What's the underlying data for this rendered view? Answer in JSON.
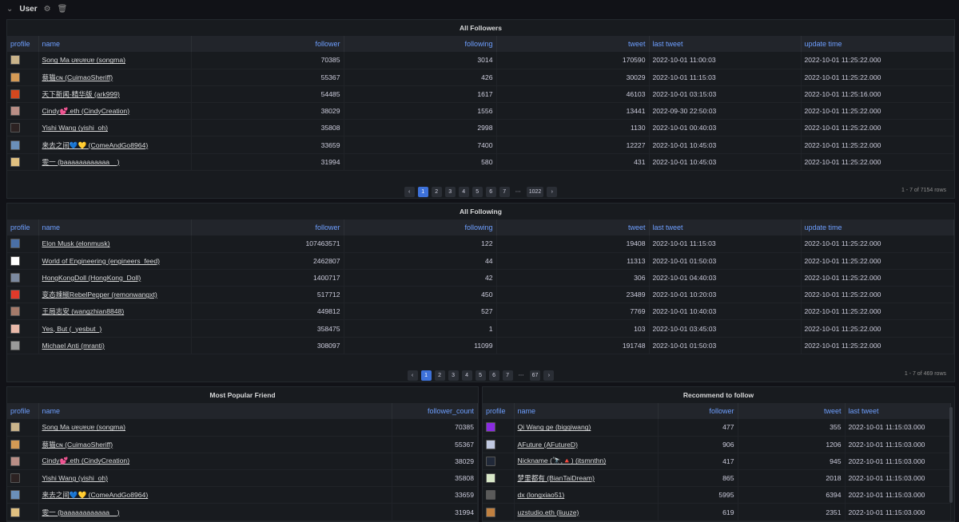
{
  "row": {
    "title": "User"
  },
  "followers": {
    "title": "All Followers",
    "headers": [
      "profile",
      "name",
      "follower",
      "following",
      "tweet",
      "last tweet",
      "update time"
    ],
    "rows": [
      {
        "color": "#c9b38a",
        "name": "Song Ma ʊɐʊɐʊɐ (songma)",
        "follower": "70385",
        "following": "3014",
        "tweet": "170590",
        "last": "2022-10-01 11:00:03",
        "update": "2022-10-01 11:25:22.000"
      },
      {
        "color": "#d49a55",
        "name": "蔡猫ᴄɴ (CuimaoSheriff)",
        "follower": "55367",
        "following": "426",
        "tweet": "30029",
        "last": "2022-10-01 11:15:03",
        "update": "2022-10-01 11:25:22.000"
      },
      {
        "color": "#d4481e",
        "name": "天下新闻-精华版 (ark999)",
        "follower": "54485",
        "following": "1617",
        "tweet": "46103",
        "last": "2022-10-01 03:15:03",
        "update": "2022-10-01 11:25:16.000"
      },
      {
        "color": "#b98e86",
        "name": "Cindy💕.eth (CindyCreation)",
        "follower": "38029",
        "following": "1556",
        "tweet": "13441",
        "last": "2022-09-30 22:50:03",
        "update": "2022-10-01 11:25:22.000"
      },
      {
        "color": "#2c2222",
        "name": "Yishi Wang (yishi_oh)",
        "follower": "35808",
        "following": "2998",
        "tweet": "1130",
        "last": "2022-10-01 00:40:03",
        "update": "2022-10-01 11:25:22.000"
      },
      {
        "color": "#6b8fb8",
        "name": "来去之间💙💛 (ComeAndGo8964)",
        "follower": "33659",
        "following": "7400",
        "tweet": "12227",
        "last": "2022-10-01 10:45:03",
        "update": "2022-10-01 11:25:22.000"
      },
      {
        "color": "#e0c080",
        "name": "雯一 (baaaaaaaaaaaa__)",
        "follower": "31994",
        "following": "580",
        "tweet": "431",
        "last": "2022-10-01 10:45:03",
        "update": "2022-10-01 11:25:22.000"
      }
    ],
    "pages": [
      "‹",
      "1",
      "2",
      "3",
      "4",
      "5",
      "6",
      "7",
      "⋯",
      "1022",
      "›"
    ],
    "active": "1",
    "count": "1 - 7 of 7154 rows"
  },
  "following": {
    "title": "All Following",
    "headers": [
      "profile",
      "name",
      "follower",
      "following",
      "tweet",
      "last tweet",
      "update time"
    ],
    "rows": [
      {
        "color": "#4a6fa5",
        "name": "Elon Musk (elonmusk)",
        "follower": "107463571",
        "following": "122",
        "tweet": "19408",
        "last": "2022-10-01 11:15:03",
        "update": "2022-10-01 11:25:22.000"
      },
      {
        "color": "#ffffff",
        "name": "World of Engineering (engineers_feed)",
        "follower": "2462807",
        "following": "44",
        "tweet": "11313",
        "last": "2022-10-01 01:50:03",
        "update": "2022-10-01 11:25:22.000"
      },
      {
        "color": "#7c8aa0",
        "name": "HongKongDoll (HongKong_Doll)",
        "follower": "1400717",
        "following": "42",
        "tweet": "306",
        "last": "2022-10-01 04:40:03",
        "update": "2022-10-01 11:25:22.000"
      },
      {
        "color": "#e03a2a",
        "name": "变态辣椒RebelPepper (remonwangxt)",
        "follower": "517712",
        "following": "450",
        "tweet": "23489",
        "last": "2022-10-01 10:20:03",
        "update": "2022-10-01 11:25:22.000"
      },
      {
        "color": "#a57a6a",
        "name": "王局志安 (wangzhian8848)",
        "follower": "449812",
        "following": "527",
        "tweet": "7769",
        "last": "2022-10-01 10:40:03",
        "update": "2022-10-01 11:25:22.000"
      },
      {
        "color": "#e8b8a8",
        "name": "Yes, But (_yesbut_)",
        "follower": "358475",
        "following": "1",
        "tweet": "103",
        "last": "2022-10-01 03:45:03",
        "update": "2022-10-01 11:25:22.000"
      },
      {
        "color": "#9a9a9a",
        "name": "Michael Anti (mranti)",
        "follower": "308097",
        "following": "11099",
        "tweet": "191748",
        "last": "2022-10-01 01:50:03",
        "update": "2022-10-01 11:25:22.000"
      }
    ],
    "pages": [
      "‹",
      "1",
      "2",
      "3",
      "4",
      "5",
      "6",
      "7",
      "⋯",
      "67",
      "›"
    ],
    "active": "1",
    "count": "1 - 7 of 469 rows"
  },
  "popular": {
    "title": "Most Popular Friend",
    "headers": [
      "profile",
      "name",
      "follower_count"
    ],
    "rows": [
      {
        "color": "#c9b38a",
        "name": "Song Ma ʊɐʊɐʊɐ (songma)",
        "count": "70385"
      },
      {
        "color": "#d49a55",
        "name": "蔡猫ᴄɴ (CuimaoSheriff)",
        "count": "55367"
      },
      {
        "color": "#b98e86",
        "name": "Cindy💕.eth (CindyCreation)",
        "count": "38029"
      },
      {
        "color": "#2c2222",
        "name": "Yishi Wang (yishi_oh)",
        "count": "35808"
      },
      {
        "color": "#6b8fb8",
        "name": "来去之间💙💛 (ComeAndGo8964)",
        "count": "33659"
      },
      {
        "color": "#e0c080",
        "name": "雯一 (baaaaaaaaaaaa__)",
        "count": "31994"
      }
    ]
  },
  "recommend": {
    "title": "Recommend to follow",
    "headers": [
      "profile",
      "name",
      "follower",
      "tweet",
      "last tweet"
    ],
    "rows": [
      {
        "color": "#8a2be2",
        "name": "Qi Wang ge (bigqiwang)",
        "follower": "477",
        "tweet": "355",
        "last": "2022-10-01 11:15:03.000"
      },
      {
        "color": "#c0c8e0",
        "name": "AFuture (AFutureD)",
        "follower": "906",
        "tweet": "1206",
        "last": "2022-10-01 11:15:03.000"
      },
      {
        "color": "#202838",
        "name": "Nickname (🔭,🔺) (itsmnthn)",
        "follower": "417",
        "tweet": "945",
        "last": "2022-10-01 11:15:03.000"
      },
      {
        "color": "#d8e8c8",
        "name": "梦里都有 (BianTaiDream)",
        "follower": "865",
        "tweet": "2018",
        "last": "2022-10-01 11:15:03.000"
      },
      {
        "color": "#5a5a5a",
        "name": "dx (longxiao51)",
        "follower": "5995",
        "tweet": "6394",
        "last": "2022-10-01 11:15:03.000"
      },
      {
        "color": "#c08040",
        "name": "uzstudio.eth (liuuze)",
        "follower": "619",
        "tweet": "2351",
        "last": "2022-10-01 11:15:03.000"
      }
    ]
  }
}
